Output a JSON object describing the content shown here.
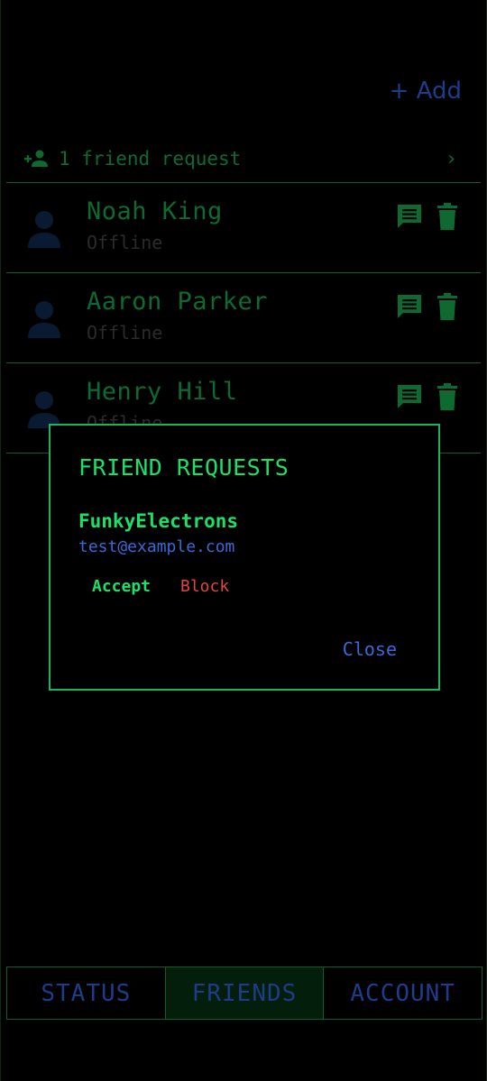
{
  "header": {
    "add_label": "+ Add"
  },
  "friend_requests_row": {
    "label": "1 friend request",
    "chevron": "›"
  },
  "friends": [
    {
      "name": "Noah King",
      "status": "Offline"
    },
    {
      "name": "Aaron Parker",
      "status": "Offline"
    },
    {
      "name": "Henry Hill",
      "status": "Offline"
    }
  ],
  "dialog": {
    "title": "FRIEND REQUESTS",
    "request": {
      "username": "FunkyElectrons",
      "email": "test@example.com",
      "accept_label": "Accept",
      "block_label": "Block"
    },
    "close_label": "Close"
  },
  "tabs": [
    {
      "label": "STATUS"
    },
    {
      "label": "FRIENDS",
      "active": true
    },
    {
      "label": "ACCOUNT"
    }
  ],
  "colors": {
    "accent_green": "#1ce06a",
    "dim_green": "#0e6a30",
    "link_blue": "#3a6ad8",
    "block_red": "#e0473a"
  },
  "icons": [
    "person-add-icon",
    "chevron-right-icon",
    "avatar-icon",
    "message-icon",
    "trash-icon"
  ]
}
